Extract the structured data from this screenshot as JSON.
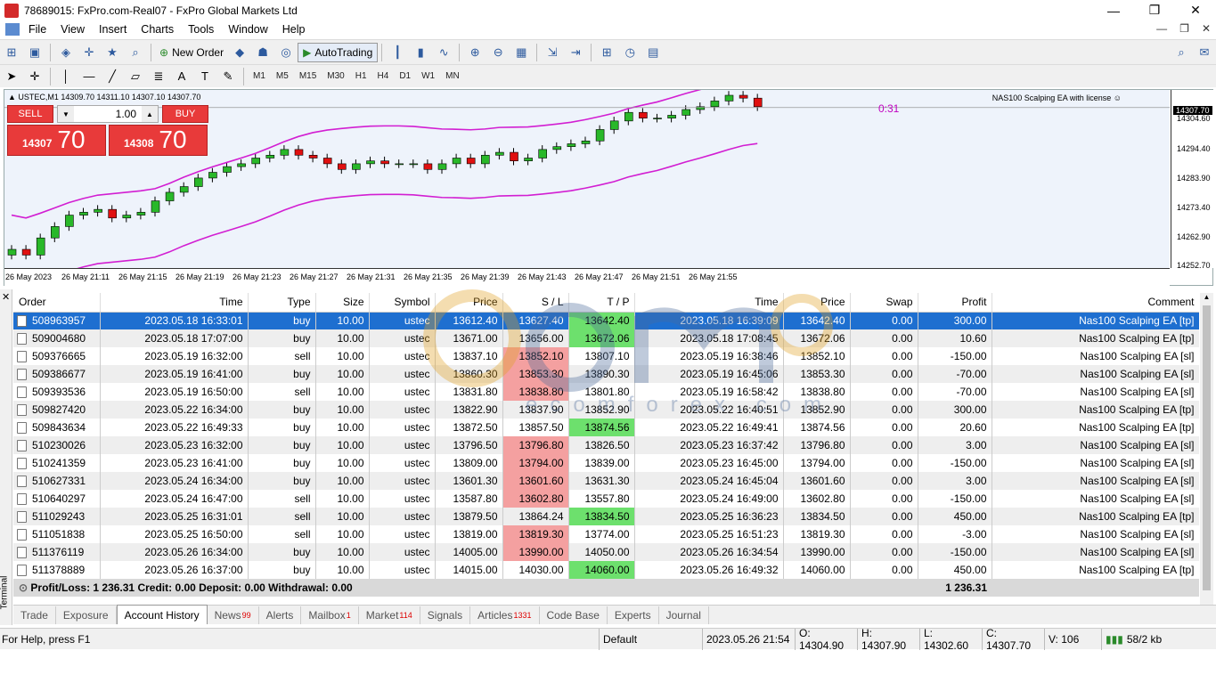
{
  "window": {
    "title": "78689015: FxPro.com-Real07 - FxPro Global Markets Ltd",
    "min": "—",
    "max": "❐",
    "close": "✕"
  },
  "menu": [
    "File",
    "View",
    "Insert",
    "Charts",
    "Tools",
    "Window",
    "Help"
  ],
  "toolbar": {
    "new_order": "New Order",
    "autotrading": "AutoTrading",
    "timeframes": [
      "M1",
      "M5",
      "M15",
      "M30",
      "H1",
      "H4",
      "D1",
      "W1",
      "MN"
    ]
  },
  "chart": {
    "info": "▲ USTEC,M1  14309.70 14311.10 14307.10 14307.70",
    "ea_label": "NAS100 Scalping EA with license ☺",
    "countdown": "0:31",
    "sell": "SELL",
    "buy": "BUY",
    "lot": "1.00",
    "bid_small": "14307",
    "bid_big": "70",
    "ask_small": "14308",
    "ask_big": "70",
    "current_price": "14307.70",
    "y_ticks": [
      "14304.60",
      "14294.40",
      "14283.90",
      "14273.40",
      "14262.90",
      "14252.70"
    ],
    "x_ticks": [
      "26 May 2023",
      "26 May 21:11",
      "26 May 21:15",
      "26 May 21:19",
      "26 May 21:23",
      "26 May 21:27",
      "26 May 21:31",
      "26 May 21:35",
      "26 May 21:39",
      "26 May 21:43",
      "26 May 21:47",
      "26 May 21:51",
      "26 May 21:55"
    ]
  },
  "table": {
    "headers": [
      "Order",
      "Time",
      "Type",
      "Size",
      "Symbol",
      "Price",
      "S / L",
      "T / P",
      "Time",
      "Price",
      "Swap",
      "Profit",
      "Comment"
    ],
    "rows": [
      [
        "508963957",
        "2023.05.18 16:33:01",
        "buy",
        "10.00",
        "ustec",
        "13612.40",
        "13627.40",
        "13642.40",
        "2023.05.18 16:39:09",
        "13642.40",
        "0.00",
        "300.00",
        "Nas100 Scalping EA [tp]"
      ],
      [
        "509004680",
        "2023.05.18 17:07:00",
        "buy",
        "10.00",
        "ustec",
        "13671.00",
        "13656.00",
        "13672.06",
        "2023.05.18 17:08:45",
        "13672.06",
        "0.00",
        "10.60",
        "Nas100 Scalping EA [tp]"
      ],
      [
        "509376665",
        "2023.05.19 16:32:00",
        "sell",
        "10.00",
        "ustec",
        "13837.10",
        "13852.10",
        "13807.10",
        "2023.05.19 16:38:46",
        "13852.10",
        "0.00",
        "-150.00",
        "Nas100 Scalping EA [sl]"
      ],
      [
        "509386677",
        "2023.05.19 16:41:00",
        "buy",
        "10.00",
        "ustec",
        "13860.30",
        "13853.30",
        "13890.30",
        "2023.05.19 16:45:06",
        "13853.30",
        "0.00",
        "-70.00",
        "Nas100 Scalping EA [sl]"
      ],
      [
        "509393536",
        "2023.05.19 16:50:00",
        "sell",
        "10.00",
        "ustec",
        "13831.80",
        "13838.80",
        "13801.80",
        "2023.05.19 16:58:42",
        "13838.80",
        "0.00",
        "-70.00",
        "Nas100 Scalping EA [sl]"
      ],
      [
        "509827420",
        "2023.05.22 16:34:00",
        "buy",
        "10.00",
        "ustec",
        "13822.90",
        "13837.90",
        "13852.90",
        "2023.05.22 16:40:51",
        "13852.90",
        "0.00",
        "300.00",
        "Nas100 Scalping EA [tp]"
      ],
      [
        "509843634",
        "2023.05.22 16:49:33",
        "buy",
        "10.00",
        "ustec",
        "13872.50",
        "13857.50",
        "13874.56",
        "2023.05.22 16:49:41",
        "13874.56",
        "0.00",
        "20.60",
        "Nas100 Scalping EA [tp]"
      ],
      [
        "510230026",
        "2023.05.23 16:32:00",
        "buy",
        "10.00",
        "ustec",
        "13796.50",
        "13796.80",
        "13826.50",
        "2023.05.23 16:37:42",
        "13796.80",
        "0.00",
        "3.00",
        "Nas100 Scalping EA [sl]"
      ],
      [
        "510241359",
        "2023.05.23 16:41:00",
        "buy",
        "10.00",
        "ustec",
        "13809.00",
        "13794.00",
        "13839.00",
        "2023.05.23 16:45:00",
        "13794.00",
        "0.00",
        "-150.00",
        "Nas100 Scalping EA [sl]"
      ],
      [
        "510627331",
        "2023.05.24 16:34:00",
        "buy",
        "10.00",
        "ustec",
        "13601.30",
        "13601.60",
        "13631.30",
        "2023.05.24 16:45:04",
        "13601.60",
        "0.00",
        "3.00",
        "Nas100 Scalping EA [sl]"
      ],
      [
        "510640297",
        "2023.05.24 16:47:00",
        "sell",
        "10.00",
        "ustec",
        "13587.80",
        "13602.80",
        "13557.80",
        "2023.05.24 16:49:00",
        "13602.80",
        "0.00",
        "-150.00",
        "Nas100 Scalping EA [sl]"
      ],
      [
        "511029243",
        "2023.05.25 16:31:01",
        "sell",
        "10.00",
        "ustec",
        "13879.50",
        "13864.24",
        "13834.50",
        "2023.05.25 16:36:23",
        "13834.50",
        "0.00",
        "450.00",
        "Nas100 Scalping EA [tp]"
      ],
      [
        "511051838",
        "2023.05.25 16:50:00",
        "sell",
        "10.00",
        "ustec",
        "13819.00",
        "13819.30",
        "13774.00",
        "2023.05.25 16:51:23",
        "13819.30",
        "0.00",
        "-3.00",
        "Nas100 Scalping EA [sl]"
      ],
      [
        "511376119",
        "2023.05.26 16:34:00",
        "buy",
        "10.00",
        "ustec",
        "14005.00",
        "13990.00",
        "14050.00",
        "2023.05.26 16:34:54",
        "13990.00",
        "0.00",
        "-150.00",
        "Nas100 Scalping EA [sl]"
      ],
      [
        "511378889",
        "2023.05.26 16:37:00",
        "buy",
        "10.00",
        "ustec",
        "14015.00",
        "14030.00",
        "14060.00",
        "2023.05.26 16:49:32",
        "14060.00",
        "0.00",
        "450.00",
        "Nas100 Scalping EA [tp]"
      ]
    ],
    "highlight": [
      [
        "",
        "green"
      ],
      [
        "",
        "green"
      ],
      [
        "red",
        ""
      ],
      [
        "red",
        ""
      ],
      [
        "red",
        ""
      ],
      [
        "",
        ""
      ],
      [
        "",
        "green"
      ],
      [
        "red",
        ""
      ],
      [
        "red",
        ""
      ],
      [
        "red",
        ""
      ],
      [
        "red",
        ""
      ],
      [
        "",
        "green"
      ],
      [
        "red",
        ""
      ],
      [
        "red",
        ""
      ],
      [
        "",
        "green"
      ]
    ],
    "summary": "Profit/Loss: 1 236.31  Credit: 0.00  Deposit: 0.00  Withdrawal: 0.00",
    "summary_profit": "1 236.31"
  },
  "tabs": [
    {
      "label": "Trade",
      "badge": ""
    },
    {
      "label": "Exposure",
      "badge": ""
    },
    {
      "label": "Account History",
      "badge": ""
    },
    {
      "label": "News",
      "badge": "99"
    },
    {
      "label": "Alerts",
      "badge": ""
    },
    {
      "label": "Mailbox",
      "badge": "1"
    },
    {
      "label": "Market",
      "badge": "114"
    },
    {
      "label": "Signals",
      "badge": ""
    },
    {
      "label": "Articles",
      "badge": "1331"
    },
    {
      "label": "Code Base",
      "badge": ""
    },
    {
      "label": "Experts",
      "badge": ""
    },
    {
      "label": "Journal",
      "badge": ""
    }
  ],
  "terminal_label": "Terminal",
  "status": {
    "help": "For Help, press F1",
    "profile": "Default",
    "time": "2023.05.26 21:54",
    "o": "O: 14304.90",
    "h": "H: 14307.90",
    "l": "L: 14302.60",
    "c": "C: 14307.70",
    "v": "V: 106",
    "traffic": "58/2 kb"
  },
  "watermark": "ecomforex.com",
  "colors": {
    "accent": "#1e6fd0",
    "sell": "#e83a3a",
    "band": "#d21ed2",
    "bull": "#29b829",
    "bear": "#e01010"
  }
}
